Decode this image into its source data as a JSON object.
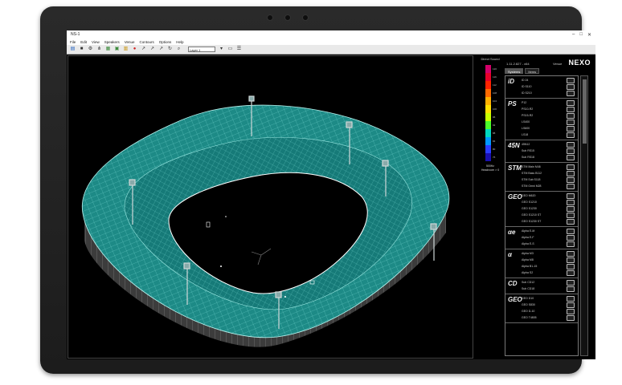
{
  "window": {
    "title": "NS-1",
    "minimize": "–",
    "maximize": "□",
    "close": "✕"
  },
  "menu": [
    "File",
    "Edit",
    "View",
    "Speakers",
    "Venue",
    "Contours",
    "Options",
    "Help"
  ],
  "toolbar": {
    "dropdown_value": "Layer 1"
  },
  "colorscale": {
    "title": "Direct Sound",
    "colors": [
      "#d4006a",
      "#e8002a",
      "#ff2200",
      "#ff6a00",
      "#ffb000",
      "#ffe000",
      "#c8ff00",
      "#4cff2a",
      "#00d8c0",
      "#0098ff",
      "#2a3cff",
      "#1a10b0"
    ],
    "labels": [
      "120",
      "116",
      "112",
      "108",
      "104",
      "100",
      "96",
      "92",
      "88",
      "84",
      "80",
      "76"
    ],
    "footer_line1": "500Hz",
    "footer_line2": "Headroom > 0"
  },
  "panel": {
    "version": "1.11.2.827 - x64",
    "venue_label": "Venue",
    "logo": "NEXO",
    "tabs": [
      {
        "label": "Systems"
      },
      {
        "label": "Items"
      }
    ],
    "families": [
      {
        "logo": "iD",
        "items": [
          "ID 24",
          "ID S110",
          "ID S210"
        ]
      },
      {
        "logo": "PS",
        "items": [
          "P12",
          "PS10-R2",
          "PS15-R2",
          "LS400",
          "LS600",
          "LS18"
        ]
      },
      {
        "logo": "45N",
        "items": [
          "45N12",
          "Sub RS15",
          "Sub RS18"
        ]
      },
      {
        "logo": "STM",
        "items": [
          "STM Main M46",
          "STM Bass B112",
          "STM Sub S118",
          "STM Omni M28"
        ]
      },
      {
        "logo": "GEO",
        "items": [
          "GEO M620",
          "GEO S1210",
          "GEO S1230",
          "GEO S1210 ST",
          "GEO S1230 ST"
        ]
      },
      {
        "logo": "αe",
        "items": [
          "Alpha E-M",
          "Alpha E-F",
          "Alpha E-S"
        ]
      },
      {
        "logo": "α",
        "items": [
          "Alpha M3",
          "Alpha M8",
          "Alpha B1-15",
          "Alpha S2"
        ]
      },
      {
        "logo": "CD",
        "items": [
          "Sub CD12",
          "Sub CD18"
        ]
      },
      {
        "logo": "GEO",
        "items": [
          "GEO D10",
          "GEO S830",
          "GEO D-10",
          "GEO T4805"
        ]
      }
    ]
  }
}
